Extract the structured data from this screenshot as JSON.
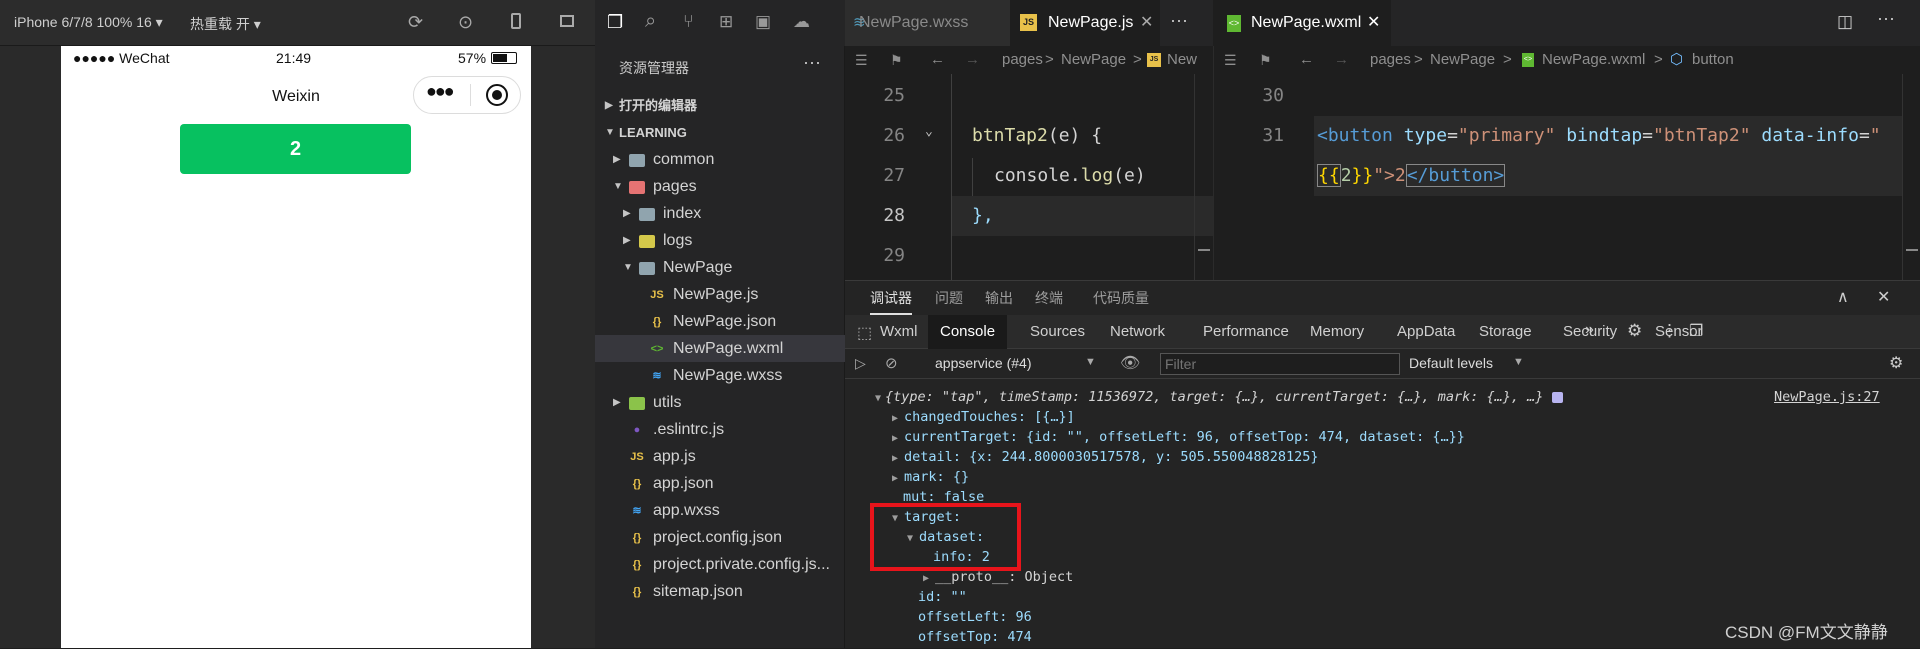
{
  "simulator": {
    "device": "iPhone 6/7/8 100% 16 ▾",
    "hot_reload": "热重载 开 ▾",
    "status": {
      "carrier": "●●●●● WeChat",
      "time": "21:49",
      "battery": "57%"
    },
    "nav_title": "Weixin",
    "button_label": "2"
  },
  "explorer": {
    "title": "资源管理器",
    "open_editors": "打开的编辑器",
    "project": "LEARNING",
    "items": [
      {
        "label": "common",
        "kind": "folder"
      },
      {
        "label": "pages",
        "kind": "folder-red"
      },
      {
        "label": "index",
        "kind": "folder"
      },
      {
        "label": "logs",
        "kind": "folder-yellow"
      },
      {
        "label": "NewPage",
        "kind": "folder-open"
      },
      {
        "label": "NewPage.js",
        "kind": "js"
      },
      {
        "label": "NewPage.json",
        "kind": "json"
      },
      {
        "label": "NewPage.wxml",
        "kind": "wxml"
      },
      {
        "label": "NewPage.wxss",
        "kind": "css"
      },
      {
        "label": "utils",
        "kind": "folder-green"
      },
      {
        "label": ".eslintrc.js",
        "kind": "eslint"
      },
      {
        "label": "app.js",
        "kind": "js"
      },
      {
        "label": "app.json",
        "kind": "json"
      },
      {
        "label": "app.wxss",
        "kind": "css"
      },
      {
        "label": "project.config.json",
        "kind": "json"
      },
      {
        "label": "project.private.config.js...",
        "kind": "json"
      },
      {
        "label": "sitemap.json",
        "kind": "json"
      }
    ]
  },
  "editor_left": {
    "tabs": [
      "NewPage.wxss",
      "NewPage.js"
    ],
    "more": "···",
    "breadcrumb": [
      "pages",
      "NewPage",
      "New"
    ],
    "line_numbers": [
      "25",
      "26",
      "27",
      "28",
      "29"
    ],
    "code": {
      "fn": "btnTap2",
      "params": "(e) {",
      "console": "console",
      "dot": ".",
      "log": "log",
      "arg": "(e)",
      "close": "},"
    }
  },
  "editor_right": {
    "tab": "NewPage.wxml",
    "breadcrumb": [
      "pages",
      "NewPage",
      "NewPage.wxml",
      "button"
    ],
    "line_numbers": [
      "30",
      "31"
    ],
    "code": {
      "open": "<button",
      "attr1": "type",
      "val1": "\"primary\"",
      "attr2": "bindtap",
      "val2": "\"btnTap2\"",
      "attr3": "data-info",
      "quote": "\"",
      "expr_open": "{{",
      "expr_val": "2",
      "expr_close": "}}",
      "tail": "\">2",
      "close_tag": "</button>"
    }
  },
  "devtools": {
    "top_tabs": [
      "调试器",
      "问题",
      "输出",
      "终端",
      "代码质量"
    ],
    "tabs": [
      "Wxml",
      "Console",
      "Sources",
      "Network",
      "Performance",
      "Memory",
      "AppData",
      "Storage",
      "Security",
      "Sensor"
    ],
    "active_tab": "Console",
    "context": "appservice (#4)",
    "filter_placeholder": "Filter",
    "levels": "Default levels",
    "source_link": "NewPage.js:27",
    "log": {
      "l0": "{type: \"tap\", timeStamp: 11536972, target: {…}, currentTarget: {…}, mark: {…}, …}",
      "l1": "changedTouches: [{…}]",
      "l2": "currentTarget: {id: \"\", offsetLeft: 96, offsetTop: 474, dataset: {…}}",
      "l3": "detail: {x: 244.8000030517578, y: 505.550048828125}",
      "l4": "mark: {}",
      "l5": "mut: false",
      "l6": "target:",
      "l7": "dataset:",
      "l8": "info: 2",
      "l9": "__proto__: Object",
      "l10": "id: \"\"",
      "l11": "offsetLeft: 96",
      "l12": "offsetTop: 474"
    }
  },
  "watermark": "CSDN @FM文文静静"
}
